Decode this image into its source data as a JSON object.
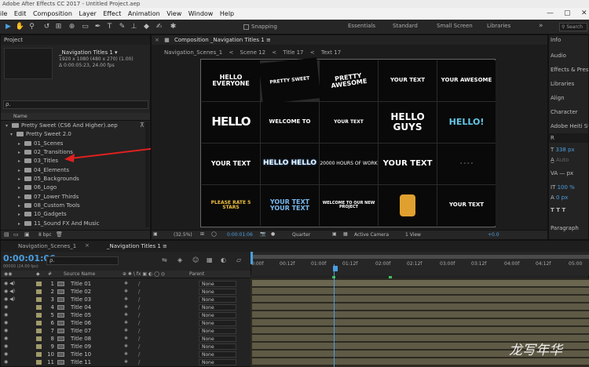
{
  "window": {
    "title": "Adobe After Effects CC 2017 - Untitled Project.aep"
  },
  "menu": [
    "ile",
    "Edit",
    "Composition",
    "Layer",
    "Effect",
    "Animation",
    "View",
    "Window",
    "Help"
  ],
  "toolbar": {
    "snapping_label": "Snapping",
    "workspaces": [
      "Essentials",
      "Standard",
      "Small Screen",
      "Libraries"
    ],
    "search_placeholder": "Search"
  },
  "project": {
    "tab_label": "Project",
    "selected_item": {
      "name": "_Navigation Titles 1 ▾",
      "line1": "1920 x 1080 (480 x 270) (1.00)",
      "line2": "Δ 0:00:05:23, 24.00 fps"
    },
    "search_placeholder": "ρ.",
    "column_name": "Name",
    "tree": [
      {
        "label": "Pretty Sweet (CS6 And Higher).aep",
        "level": 0,
        "open": true
      },
      {
        "label": "Pretty Sweet 2.0",
        "level": 1,
        "open": true
      },
      {
        "label": "01_Scenes",
        "level": 2
      },
      {
        "label": "02_Transitions",
        "level": 2
      },
      {
        "label": "03_Titles",
        "level": 2
      },
      {
        "label": "04_Elements",
        "level": 2
      },
      {
        "label": "05_Backgrounds",
        "level": 2
      },
      {
        "label": "06_Logo",
        "level": 2
      },
      {
        "label": "07_Lower Thirds",
        "level": 2
      },
      {
        "label": "08_Custom Tools",
        "level": 2
      },
      {
        "label": "10_Gadgets",
        "level": 2
      },
      {
        "label": "11_Sound FX And Music",
        "level": 2
      }
    ],
    "bpc_label": "8 bpc"
  },
  "composition": {
    "tab_label": "Composition _Navigation Titles 1 ≡",
    "breadcrumbs": [
      "Navigation_Scenes_1",
      "Scene 12",
      "Title 17",
      "Text 17"
    ],
    "cells": [
      "HELLO EVERYONE",
      "PRETTY SWEET",
      "PRETTY AWESOME",
      "YOUR TEXT",
      "YOUR AWESOME",
      "HELLO",
      "WELCOME TO",
      "YOUR TEXT",
      "HELLO GUYS",
      "HELLO!",
      "YOUR TEXT",
      "HELLO HELLO",
      "20000 HOURS OF WORK",
      "YOUR TEXT",
      "- - - -",
      "PLEASE RATE 5 STARS",
      "YOUR TEXT YOUR TEXT",
      "WELCOME TO OUR NEW PROJECT",
      "",
      "YOUR TEXT"
    ],
    "viewer_bar": {
      "zoom": "(32.5%)",
      "timecode": "0:00:01:06",
      "resolution": "Quarter",
      "camera": "Active Camera",
      "view": "1 View",
      "exposure": "+0.0"
    }
  },
  "right_panel": {
    "items": [
      "Info",
      "Audio",
      "Effects & Presets",
      "Libraries",
      "Align",
      "Character"
    ],
    "font_name": "Adobe Heiti Std",
    "font_style": "R",
    "font_size": "338 px",
    "leading": "Auto",
    "kerning": "— px",
    "scale": "100 %",
    "baseline": "0 px",
    "paragraph": "Paragraph",
    "accent": "#4a9ee0"
  },
  "timeline": {
    "tabs": [
      "Navigation_Scenes_1",
      "_Navigation Titles 1 ≡"
    ],
    "timecode": "0:00:01:06",
    "fps": "00030 (24.00 fps)",
    "search_placeholder": "ρ.",
    "col_source": "Source Name",
    "col_parent": "Parent",
    "ruler": [
      "0:00f",
      "00:12f",
      "01:00f",
      "01:12f",
      "02:00f",
      "02:12f",
      "03:00f",
      "03:12f",
      "04:00f",
      "04:12f",
      "05:00"
    ],
    "layers": [
      {
        "num": "1",
        "name": "Title 01",
        "parent": "None"
      },
      {
        "num": "2",
        "name": "Title 02",
        "parent": "None"
      },
      {
        "num": "3",
        "name": "Title 03",
        "parent": "None"
      },
      {
        "num": "4",
        "name": "Title 04",
        "parent": "None"
      },
      {
        "num": "5",
        "name": "Title 05",
        "parent": "None"
      },
      {
        "num": "6",
        "name": "Title 06",
        "parent": "None"
      },
      {
        "num": "7",
        "name": "Title 07",
        "parent": "None"
      },
      {
        "num": "8",
        "name": "Title 08",
        "parent": "None"
      },
      {
        "num": "9",
        "name": "Title 09",
        "parent": "None"
      },
      {
        "num": "10",
        "name": "Title 10",
        "parent": "None"
      },
      {
        "num": "11",
        "name": "Title 11",
        "parent": "None"
      }
    ]
  },
  "watermark": "龙写年华"
}
